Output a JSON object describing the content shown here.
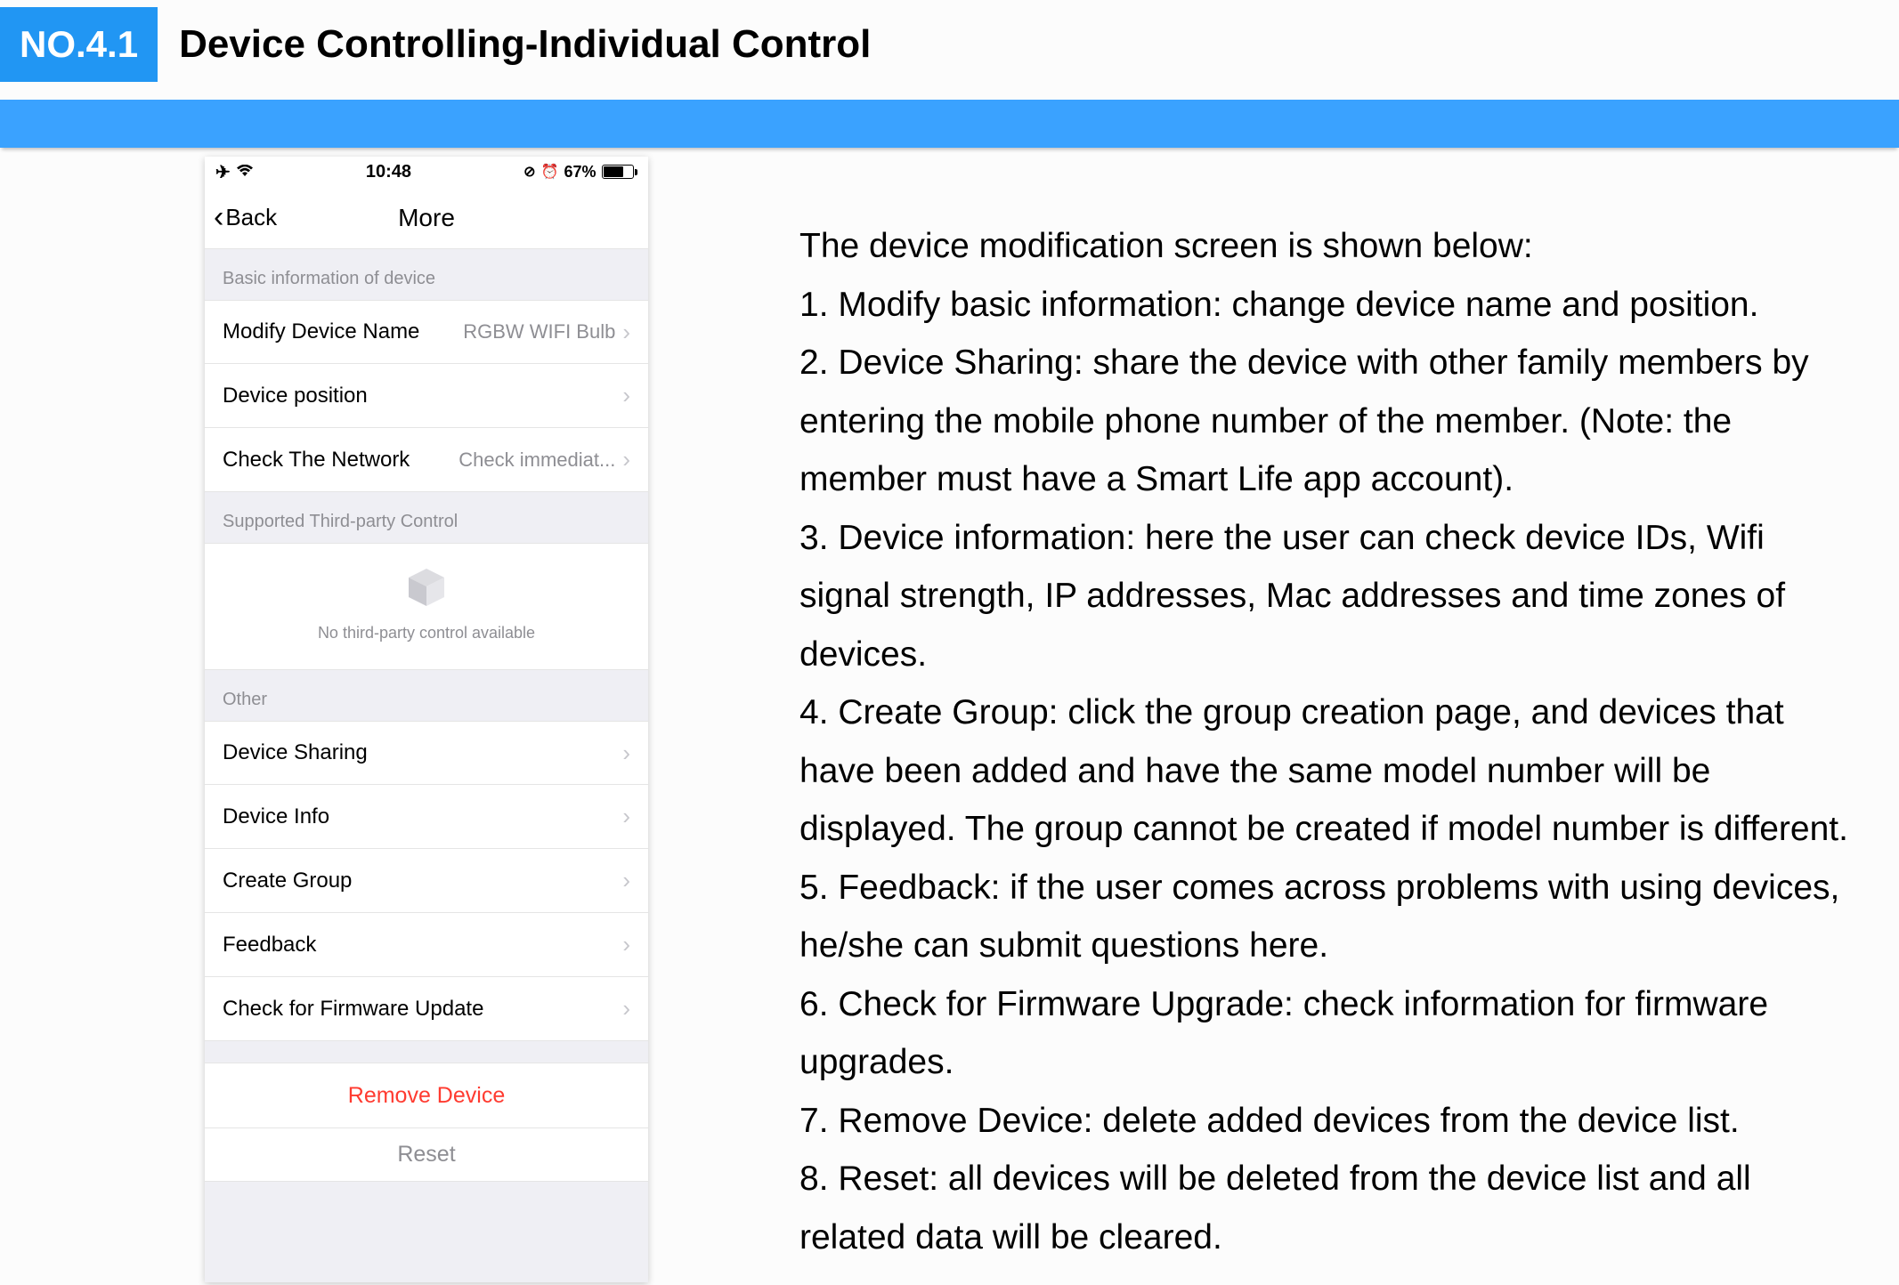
{
  "header": {
    "badge": "NO.4.1",
    "title": "Device Controlling-Individual Control"
  },
  "phone": {
    "status": {
      "time": "10:48",
      "battery_pct": "67%"
    },
    "nav": {
      "back": "Back",
      "title": "More"
    },
    "sections": {
      "basic_header": "Basic information of device",
      "third_party_header": "Supported Third-party Control",
      "no_third_party": "No third-party control available",
      "other_header": "Other"
    },
    "rows": {
      "modify_name": {
        "label": "Modify Device Name",
        "value": "RGBW WIFI Bulb"
      },
      "position": {
        "label": "Device position",
        "value": ""
      },
      "check_network": {
        "label": "Check The Network",
        "value": "Check immediat..."
      },
      "sharing": {
        "label": "Device Sharing"
      },
      "info": {
        "label": "Device Info"
      },
      "group": {
        "label": "Create Group"
      },
      "feedback": {
        "label": "Feedback"
      },
      "firmware": {
        "label": "Check for Firmware Update"
      }
    },
    "actions": {
      "remove": "Remove Device",
      "reset": "Reset"
    }
  },
  "body": {
    "intro": "The device modification screen is shown below:",
    "p1": "1. Modify basic information: change device name and position.",
    "p2": "2. Device Sharing: share the device with other family members by entering the mobile phone number of the member. (Note: the member must have  a Smart Life app account).",
    "p3": "3. Device information: here the user can check device IDs, Wifi signal strength, IP addresses, Mac addresses and time zones of devices.",
    "p4": "4. Create Group: click the group creation page, and devices that have been added and have  the same model number will be displayed. The group cannot be created if model number is different.",
    "p5": "5. Feedback: if the user comes across problems with using devices, he/she can submit questions here.",
    "p6": "6. Check for Firmware Upgrade: check information for firmware upgrades.",
    "p7": "7. Remove Device: delete added devices from the device list.",
    "p8": "8. Reset: all devices will be deleted from the device list and all related data will be cleared."
  }
}
